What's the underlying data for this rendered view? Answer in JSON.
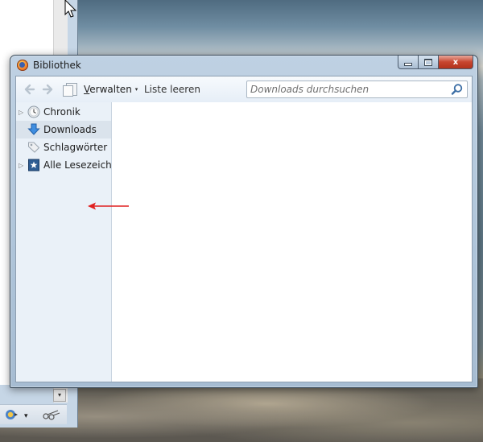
{
  "window": {
    "title": "Bibliothek",
    "close_glyph": "x"
  },
  "toolbar": {
    "back_icon": "arrow-left-icon",
    "forward_icon": "arrow-right-icon",
    "organize_first": "V",
    "organize_rest": "erwalten",
    "organize_arrow": "▾",
    "clear_label": "Liste leeren",
    "search_placeholder": "Downloads durchsuchen"
  },
  "sidebar": {
    "items": [
      {
        "label": "Chronik",
        "icon": "clock-icon",
        "expandable": true,
        "selected": false
      },
      {
        "label": "Downloads",
        "icon": "download-arrow-icon",
        "expandable": false,
        "selected": true
      },
      {
        "label": "Schlagwörter",
        "icon": "tag-icon",
        "expandable": false,
        "selected": false
      },
      {
        "label": "Alle Lesezeich...",
        "icon": "bookmark-star-icon",
        "expandable": true,
        "selected": false
      }
    ]
  },
  "colors": {
    "sidebar_bg": "#eaf1f8",
    "selected_row": "#dae3ec",
    "annotation_arrow": "#e02020"
  },
  "background_window": {
    "scroll_down_glyph": "▾"
  }
}
